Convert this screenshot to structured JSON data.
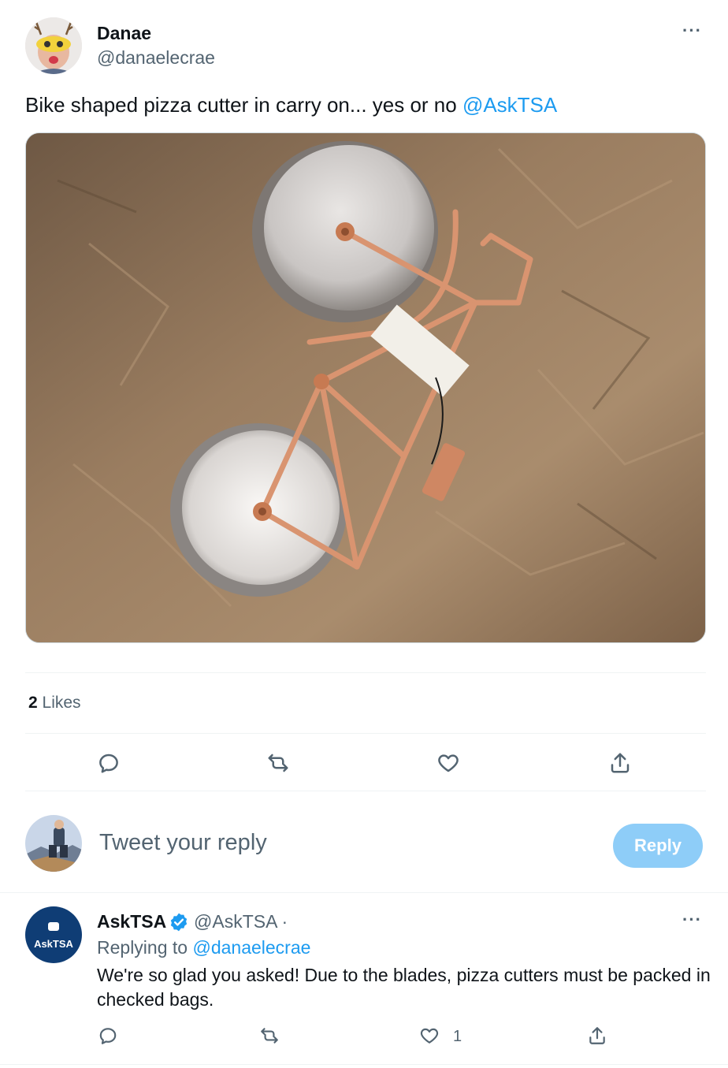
{
  "tweet": {
    "author_name": "Danae",
    "author_handle": "@danaelecrae",
    "text": "Bike shaped pizza cutter in carry on... yes or no ",
    "mention": "@AskTSA",
    "media_icon": "photo-bicycle-pizza-cutter",
    "likes_count": "2",
    "likes_label": " Likes",
    "actions": [
      "reply-icon",
      "retweet-icon",
      "like-icon",
      "share-icon"
    ]
  },
  "composer": {
    "placeholder": "Tweet your reply",
    "reply_button": "Reply"
  },
  "reply": {
    "author_name": "AskTSA",
    "author_handle": "@AskTSA",
    "handle_sep": " ·",
    "avatar_text": "AskTSA",
    "replying_prefix": "Replying to ",
    "replying_handle": "@danaelecrae",
    "text": "We're so glad you asked! Due to the blades, pizza cutters must be packed in checked bags.",
    "like_count": "1"
  },
  "colors": {
    "accent": "#1d9bf0",
    "reply_button_disabled": "#8ecdf8",
    "secondary_text": "#536471"
  }
}
